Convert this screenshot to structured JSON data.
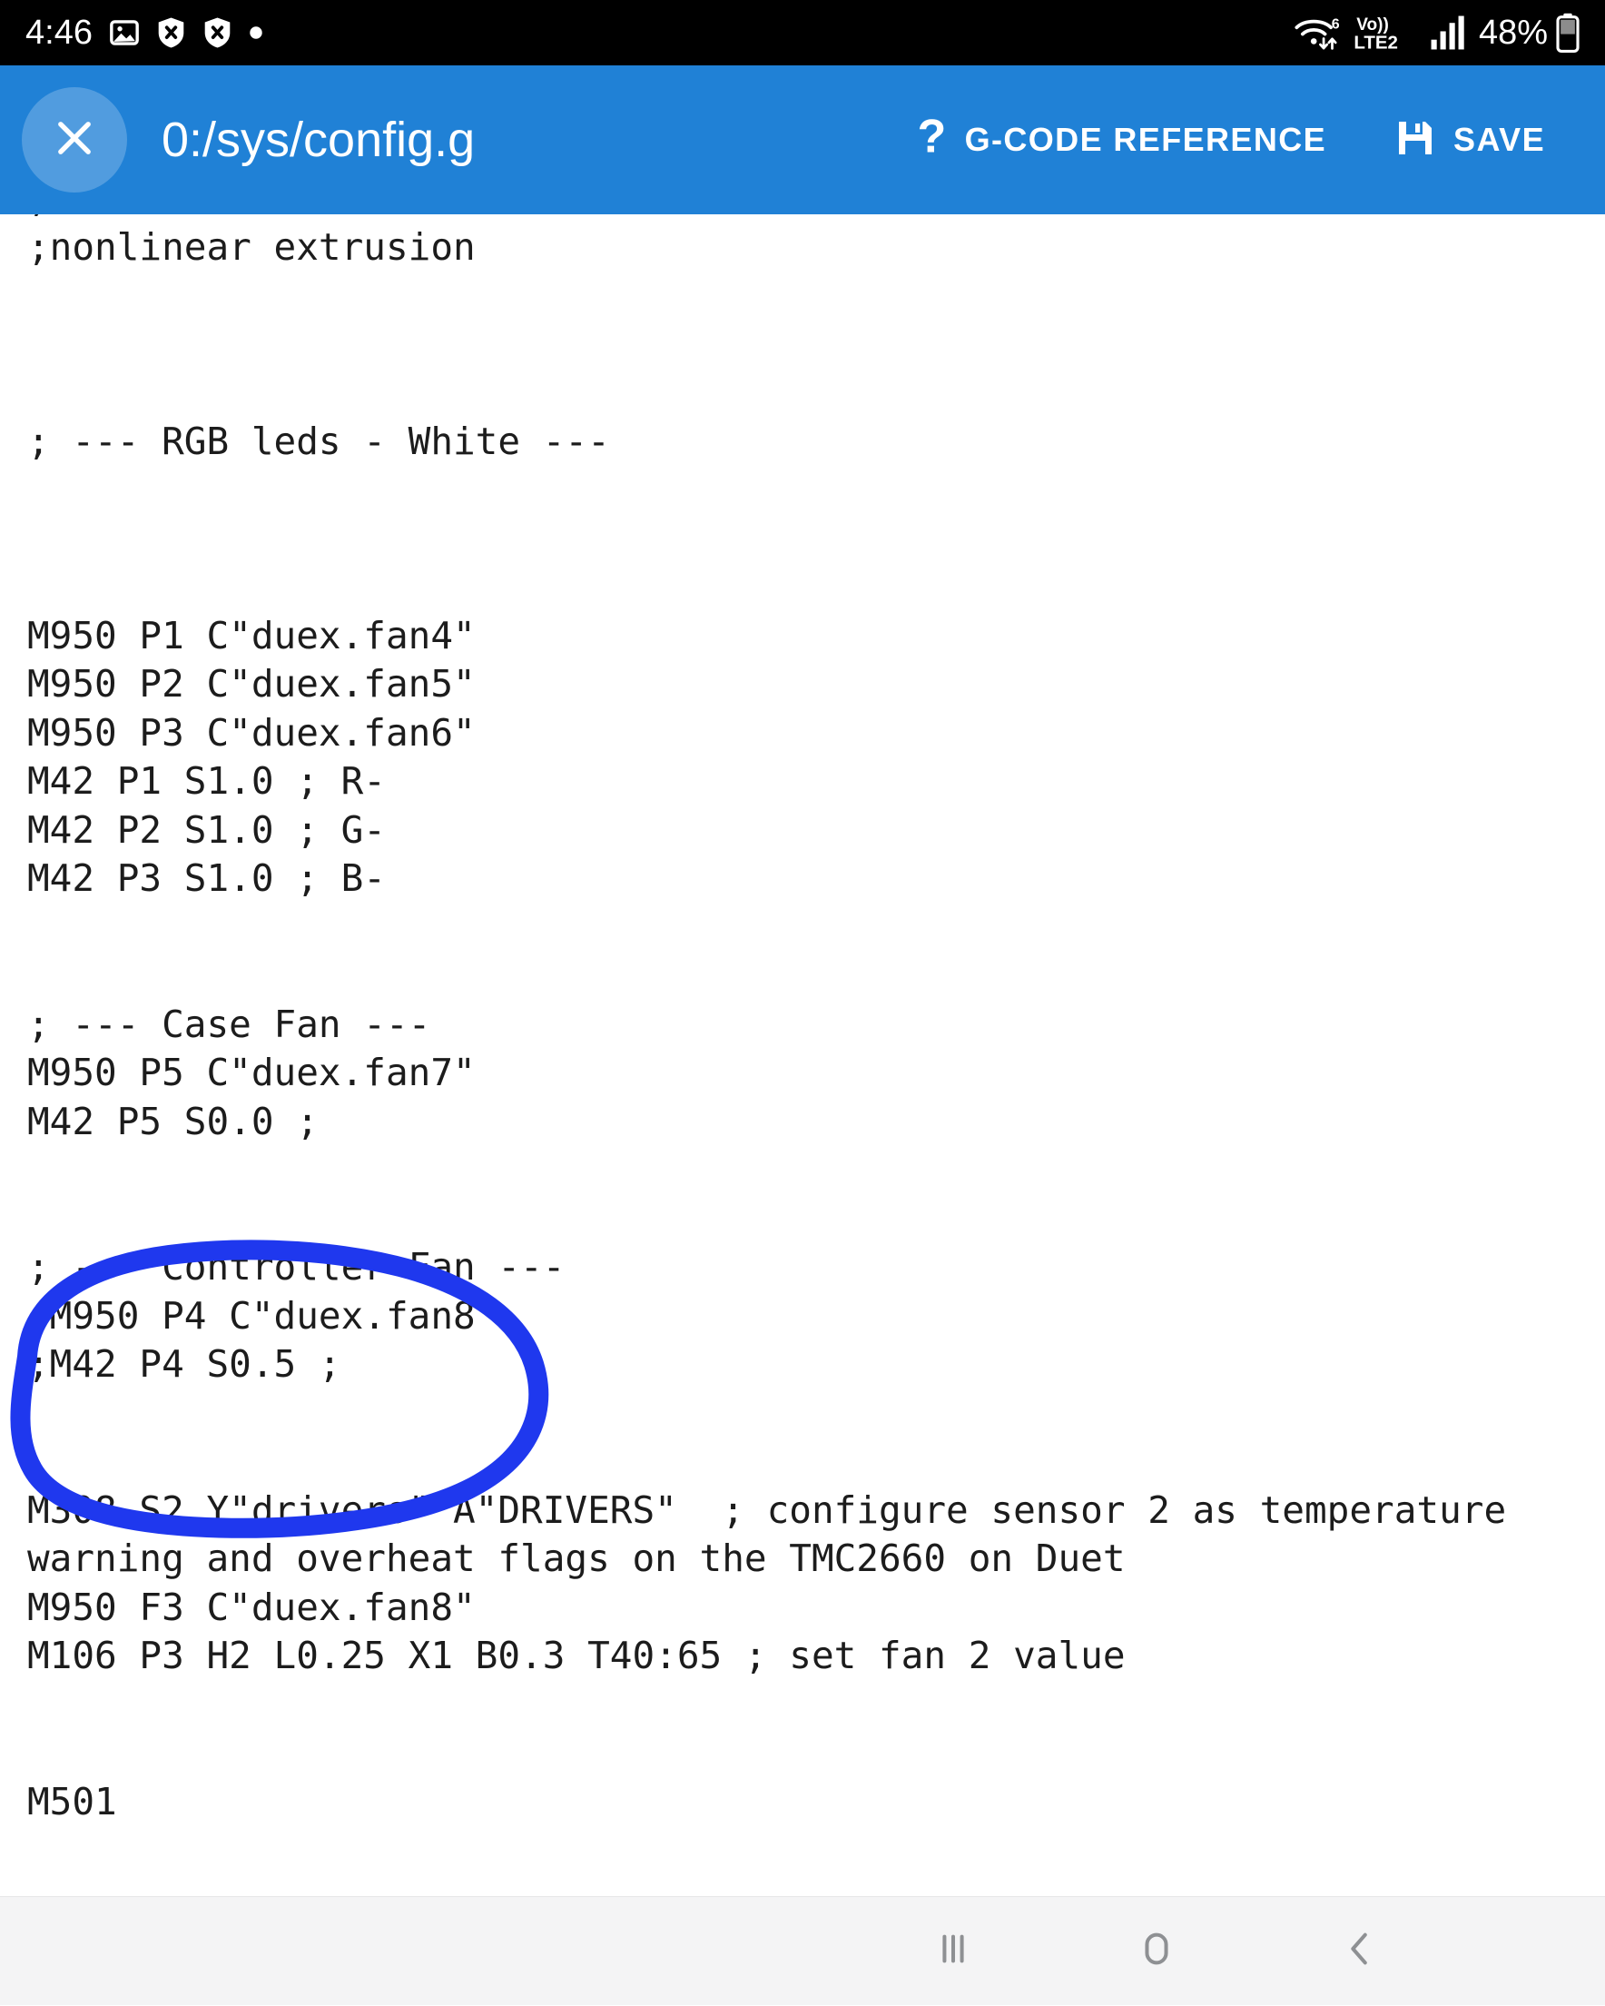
{
  "status_bar": {
    "time": "4:46",
    "icons_left": [
      "image-icon",
      "shield-block-icon",
      "shield-block-icon",
      "dot-icon"
    ],
    "network": {
      "wifi": "wifi-6-icon",
      "wifi_generation": "6",
      "volte_label": "Vo))",
      "network_type": "LTE2",
      "signal": "signal-bars-icon"
    },
    "battery_percent": "48%",
    "background_color": "#000000"
  },
  "header": {
    "title": "0:/sys/config.g",
    "close_label": "×",
    "gcode_reference_label": "G-CODE REFERENCE",
    "gcode_reference_icon": "question-mark-icon",
    "save_label": "SAVE",
    "save_icon": "floppy-disk-icon",
    "background_color": "#2081d6"
  },
  "editor": {
    "lines": [
      ";",
      ";nonlinear extrusion",
      "",
      "",
      "",
      "; --- RGB leds - White ---",
      "",
      "",
      "",
      "M950 P1 C\"duex.fan4\"",
      "M950 P2 C\"duex.fan5\"",
      "M950 P3 C\"duex.fan6\"",
      "M42 P1 S1.0 ; R-",
      "M42 P2 S1.0 ; G-",
      "M42 P3 S1.0 ; B-",
      "",
      "",
      "; --- Case Fan ---",
      "M950 P5 C\"duex.fan7\"",
      "M42 P5 S0.0 ;",
      "",
      "",
      "; --- Controller Fan ---",
      ";M950 P4 C\"duex.fan8\"",
      ";M42 P4 S0.5 ;",
      "",
      ""
    ],
    "wrapped_lines": [
      {
        "text": "M308 S2 Y\"drivers\" A\"DRIVERS\"  ; configure sensor 2 as temperature warning and overheat flags on the TMC2660 on Duet"
      }
    ],
    "trailing_lines": [
      "M950 F3 C\"duex.fan8\"",
      "M106 P3 H2 L0.25 X1 B0.3 T40:65 ; set fan 2 value",
      "",
      "",
      "M501"
    ],
    "text_color": "#1c1c1c",
    "background_color": "#ffffff"
  },
  "annotation": {
    "type": "hand-drawn-ellipse",
    "color": "#1f38ee",
    "stroke_width": "22",
    "encircles": "Controller Fan block"
  },
  "nav_bar": {
    "recents_label": "|||",
    "home_label": "home",
    "back_label": "back",
    "background_color": "#f4f4f5"
  }
}
